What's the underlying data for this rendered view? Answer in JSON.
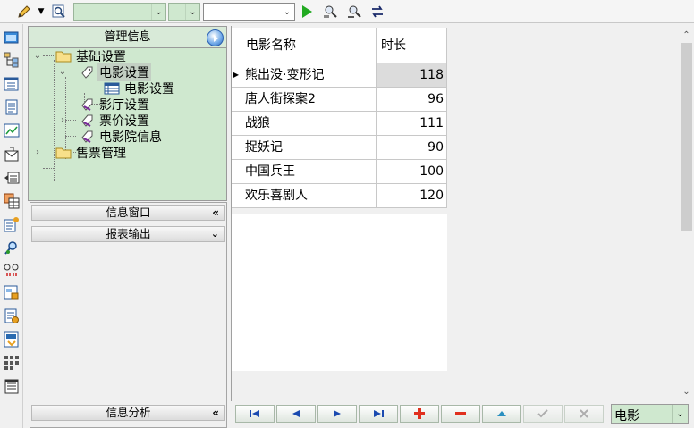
{
  "toolbar": {
    "icons": [
      "pencil-icon",
      "dropdown-arrow-icon",
      "magnifier-icon",
      "play-icon",
      "find-icon",
      "find-next-icon",
      "refresh-icon"
    ],
    "combo1_value": "",
    "combo2_value": "",
    "combo3_value": ""
  },
  "sidebar_strip": {
    "icons": [
      "window-icon",
      "hierarchy-icon",
      "list-icon",
      "document-icon",
      "chart-icon",
      "mail-icon",
      "report-icon",
      "table-icon",
      "settings-icon",
      "search-users-icon",
      "link-icon",
      "form-icon",
      "doc-settings-icon",
      "export-icon",
      "grid-icon",
      "print-icon"
    ]
  },
  "nav": {
    "title": "管理信息",
    "tree": [
      {
        "label": "基础设置",
        "level": 0,
        "icon": "folder-icon"
      },
      {
        "label": "电影设置",
        "level": 1,
        "icon": "tag-icon",
        "selected": true
      },
      {
        "label": "电影设置",
        "level": 2,
        "icon": "grid-form-icon"
      },
      {
        "label": "影厅设置",
        "level": 1,
        "icon": "tag-icon"
      },
      {
        "label": "票价设置",
        "level": 1,
        "icon": "tag-icon"
      },
      {
        "label": "电影院信息",
        "level": 1,
        "icon": "tag-icon"
      },
      {
        "label": "售票管理",
        "level": 0,
        "icon": "folder-icon"
      }
    ],
    "panels": {
      "info_window": "信息窗口",
      "report_output": "报表输出",
      "info_analysis": "信息分析"
    }
  },
  "grid": {
    "columns": [
      "电影名称",
      "时长"
    ],
    "rows": [
      {
        "name": "熊出没·变形记",
        "duration": "118"
      },
      {
        "name": "唐人街探案2",
        "duration": "96"
      },
      {
        "name": "战狼",
        "duration": "111"
      },
      {
        "name": "捉妖记",
        "duration": "90"
      },
      {
        "name": "中国兵王",
        "duration": "100"
      },
      {
        "name": "欢乐喜剧人",
        "duration": "120"
      }
    ],
    "current_row": 0
  },
  "navigator": {
    "buttons": [
      "first",
      "prior",
      "next",
      "last",
      "insert",
      "delete",
      "edit",
      "post",
      "cancel"
    ],
    "filter_value": "电影"
  },
  "colors": {
    "accent_green": "#cfe8cf",
    "add_red": "#e0301e",
    "play_green": "#22aa22"
  }
}
